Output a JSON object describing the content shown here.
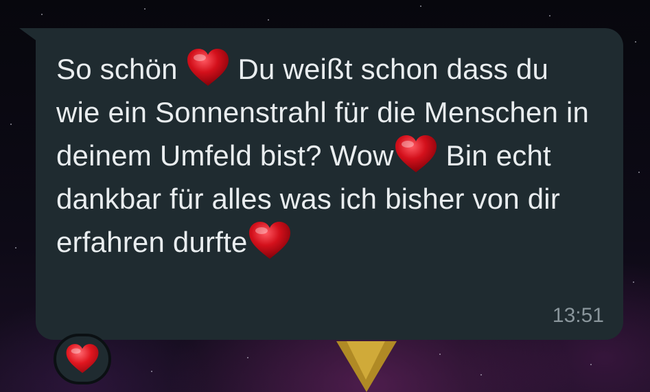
{
  "chat": {
    "message": {
      "parts": [
        "So schön ",
        " Du weißt schon dass du wie ein Sonnenstrahl für die Menschen in deinem Umfeld bist? Wow",
        " Bin echt dankbar für alles was ich bisher von dir erfahren durfte"
      ],
      "emoji": [
        "heart-emoji",
        "heart-emoji",
        "heart-emoji"
      ],
      "time": "13:51"
    },
    "reaction": {
      "emoji": "heart-emoji"
    }
  },
  "colors": {
    "bubble": "#1f2b30",
    "text": "#e9edef",
    "timestamp": "#8a969c",
    "heart": "#d3101b"
  }
}
